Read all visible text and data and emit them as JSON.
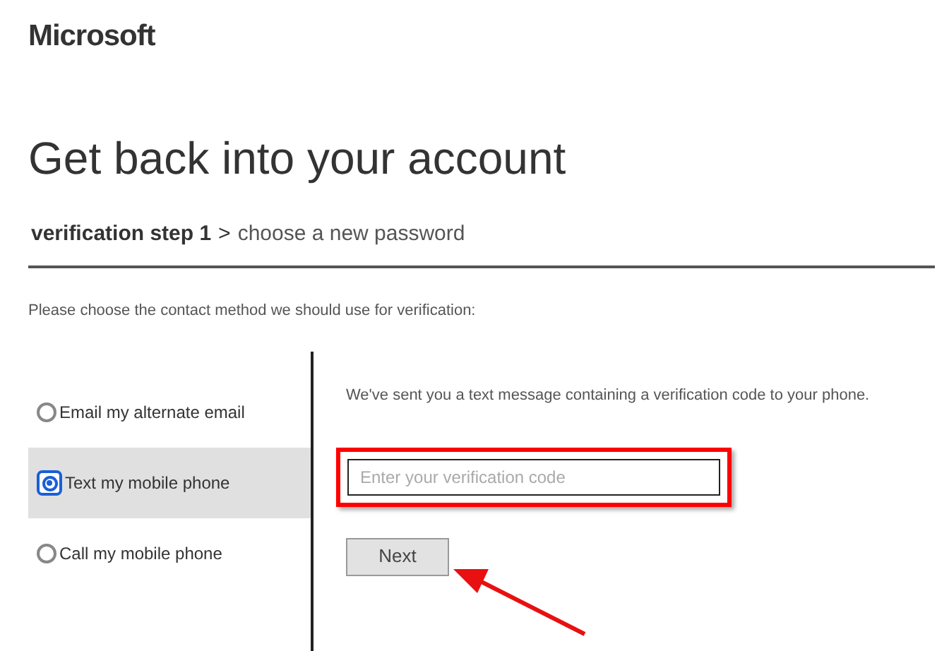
{
  "brand": "Microsoft",
  "title": "Get back into your account",
  "steps": [
    {
      "label": "verification step 1",
      "selected": true
    },
    {
      "label": "choose a new password",
      "selected": false
    }
  ],
  "step_separator": ">",
  "instruction": "Please choose the contact method we should use for verification:",
  "methods": [
    {
      "label": "Email my alternate email",
      "selected": false
    },
    {
      "label": "Text my mobile phone",
      "selected": true
    },
    {
      "label": "Call my mobile phone",
      "selected": false
    }
  ],
  "message": "We've sent you a text message containing a verification code to your phone.",
  "code_field": {
    "placeholder": "Enter your verification code",
    "highlighted": true
  },
  "next_button": {
    "label": "Next",
    "pointed_at": true
  }
}
